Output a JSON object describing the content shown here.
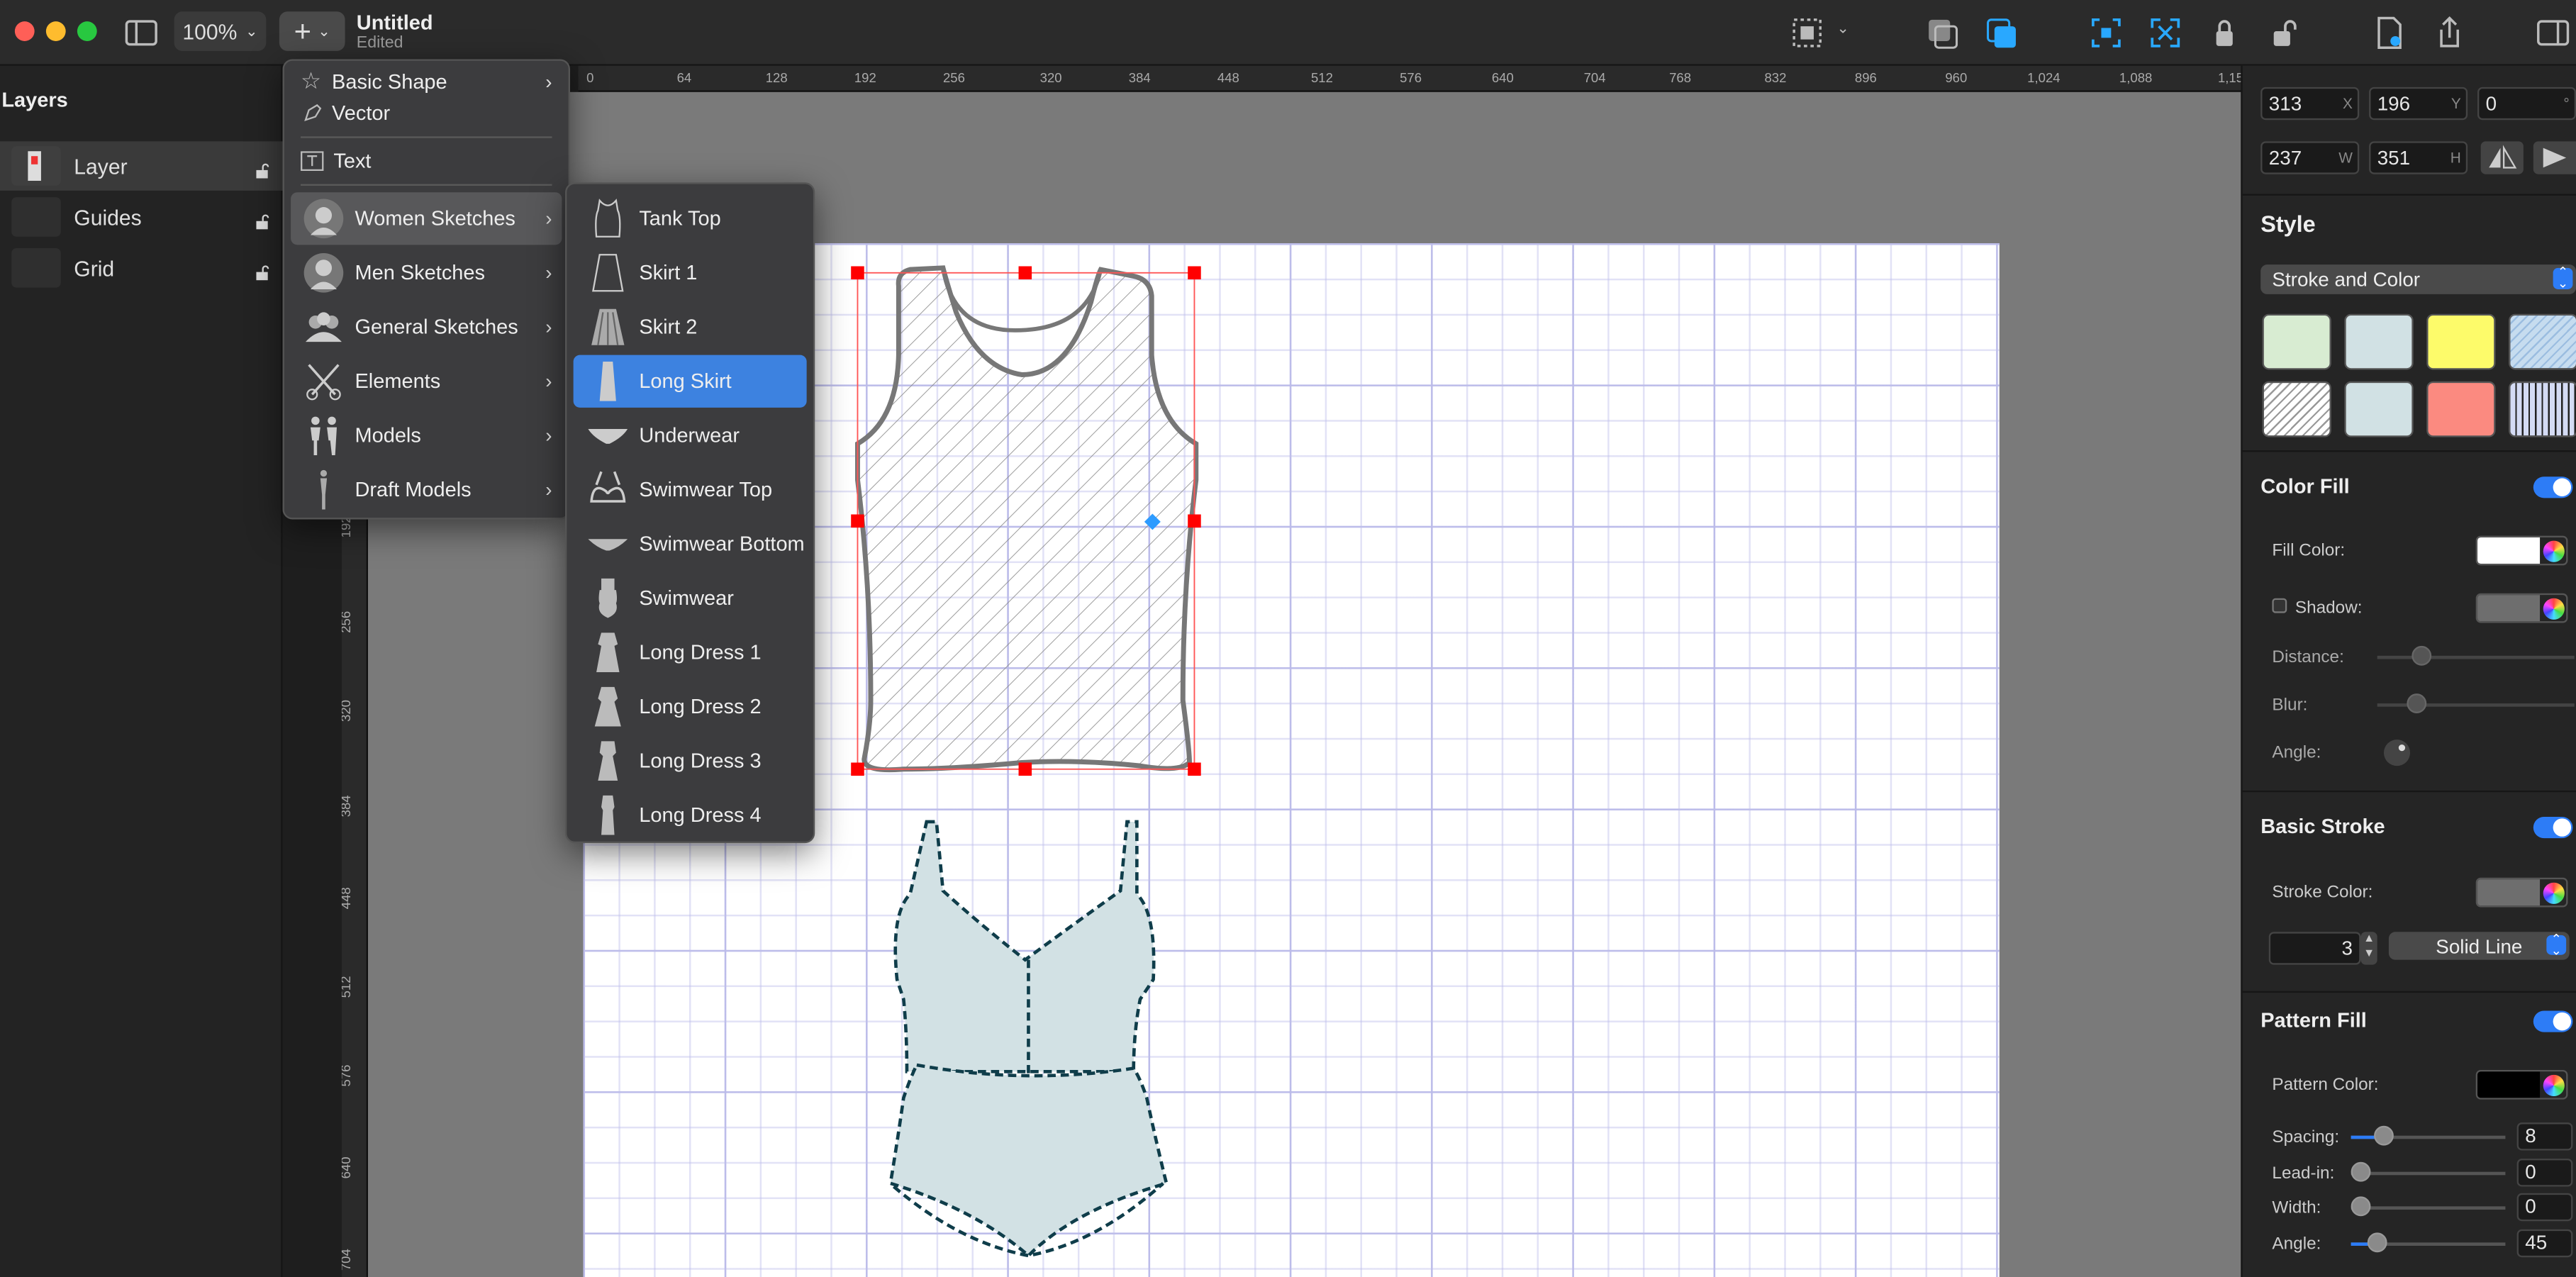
{
  "toolbar": {
    "zoom": "100%",
    "doc_title": "Untitled",
    "doc_status": "Edited",
    "add_icon": "plus-icon",
    "sidebar_icon": "sidebar-toggle-icon"
  },
  "layers": {
    "title": "Layers",
    "items": [
      {
        "name": "Layer"
      },
      {
        "name": "Guides"
      },
      {
        "name": "Grid"
      }
    ]
  },
  "ruler": {
    "top_ticks": [
      "0",
      "64",
      "128",
      "192",
      "256",
      "320",
      "384",
      "448",
      "512",
      "576",
      "640",
      "704",
      "768",
      "832",
      "896",
      "960",
      "1,024",
      "1,088",
      "1,15"
    ],
    "left_ticks": [
      "192",
      "256",
      "320",
      "384",
      "448",
      "512",
      "576",
      "640",
      "704"
    ]
  },
  "add_menu": {
    "items": [
      {
        "label": "Basic Shape",
        "icon": "star-icon",
        "submenu": true
      },
      {
        "label": "Vector",
        "icon": "pen-icon",
        "submenu": false
      },
      {
        "label": "Text",
        "icon": "text-icon",
        "submenu": false
      },
      {
        "label": "Women Sketches",
        "icon": "woman-icon",
        "submenu": true
      },
      {
        "label": "Men Sketches",
        "icon": "man-icon",
        "submenu": true
      },
      {
        "label": "General Sketches",
        "icon": "people-icon",
        "submenu": true
      },
      {
        "label": "Elements",
        "icon": "scissors-icon",
        "submenu": true
      },
      {
        "label": "Models",
        "icon": "models-icon",
        "submenu": true
      },
      {
        "label": "Draft Models",
        "icon": "draft-model-icon",
        "submenu": true
      }
    ]
  },
  "women_menu": {
    "items": [
      {
        "label": "Tank Top"
      },
      {
        "label": "Skirt 1"
      },
      {
        "label": "Skirt 2"
      },
      {
        "label": "Long Skirt"
      },
      {
        "label": "Underwear"
      },
      {
        "label": "Swimwear Top"
      },
      {
        "label": "Swimwear Bottom"
      },
      {
        "label": "Swimwear"
      },
      {
        "label": "Long Dress 1"
      },
      {
        "label": "Long Dress 2"
      },
      {
        "label": "Long Dress 3"
      },
      {
        "label": "Long Dress 4"
      }
    ],
    "selected": "Long Skirt"
  },
  "inspector": {
    "x": "313",
    "x_suffix": "X",
    "y": "196",
    "y_suffix": "Y",
    "r": "0",
    "r_suffix": "°",
    "w": "237",
    "w_suffix": "W",
    "h": "351",
    "h_suffix": "H",
    "style_title": "Style",
    "style_select": "Stroke and Color",
    "color_fill": {
      "title": "Color Fill",
      "fill_color_label": "Fill Color:",
      "fill_color": "#ffffff",
      "shadow_label": "Shadow:",
      "shadow_color": "#6e6e6e",
      "distance_label": "Distance:",
      "blur_label": "Blur:",
      "angle_label": "Angle:"
    },
    "basic_stroke": {
      "title": "Basic Stroke",
      "stroke_color_label": "Stroke Color:",
      "stroke_color": "#6e6e6e",
      "width": "3",
      "line_style": "Solid Line"
    },
    "pattern_fill": {
      "title": "Pattern Fill",
      "pattern_color_label": "Pattern Color:",
      "pattern_color": "#000000",
      "spacing_label": "Spacing:",
      "spacing": "8",
      "leadin_label": "Lead-in:",
      "leadin": "0",
      "width_label": "Width:",
      "width": "0",
      "angle_label": "Angle:",
      "angle": "45"
    }
  },
  "colors": {
    "accent": "#3d82e0",
    "toggle": "#2d7cf6",
    "selection": "#ff0000",
    "swimwear_fill": "#d2e1e4",
    "swimwear_stroke": "#0f3d4a"
  }
}
